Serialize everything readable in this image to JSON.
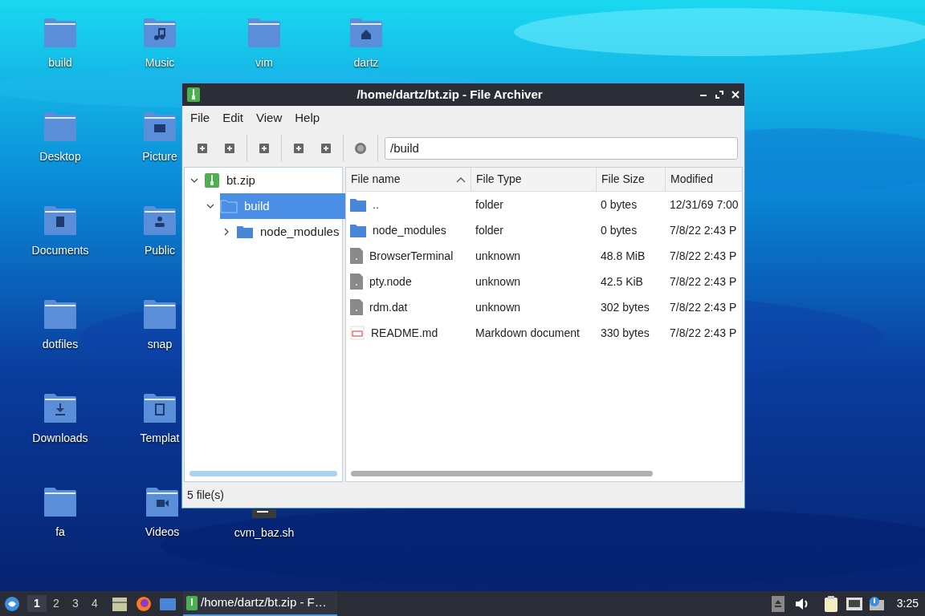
{
  "desktop": {
    "icons": [
      {
        "label": "build",
        "kind": "folder"
      },
      {
        "label": "Desktop",
        "kind": "folder"
      },
      {
        "label": "Documents",
        "kind": "documents"
      },
      {
        "label": "dotfiles",
        "kind": "folder"
      },
      {
        "label": "Downloads",
        "kind": "downloads"
      },
      {
        "label": "fa",
        "kind": "folder"
      },
      {
        "label": "Music",
        "kind": "music"
      },
      {
        "label": "Picture",
        "kind": "pictures"
      },
      {
        "label": "Public",
        "kind": "public"
      },
      {
        "label": "snap",
        "kind": "folder"
      },
      {
        "label": "Templat",
        "kind": "templates"
      },
      {
        "label": "Videos",
        "kind": "videos"
      },
      {
        "label": "vim",
        "kind": "folder"
      },
      {
        "label": "cvm_baz.sh",
        "kind": "script"
      },
      {
        "label": "dartz",
        "kind": "home"
      }
    ]
  },
  "window": {
    "title": "/home/dartz/bt.zip - File Archiver",
    "menu": [
      "File",
      "Edit",
      "View",
      "Help"
    ],
    "location": "/build",
    "tree": [
      {
        "label": "bt.zip",
        "kind": "archive",
        "expanded": true,
        "selected": false,
        "children": [
          {
            "label": "build",
            "kind": "folder",
            "expanded": true,
            "selected": true,
            "children": [
              {
                "label": "node_modules",
                "kind": "folder",
                "expanded": false,
                "selected": false
              }
            ]
          }
        ]
      }
    ],
    "table": {
      "columns": [
        {
          "label": "File name",
          "sorted": true
        },
        {
          "label": "File Type",
          "sorted": false
        },
        {
          "label": "File Size",
          "sorted": false
        },
        {
          "label": "Modified",
          "sorted": false
        }
      ],
      "rows": [
        {
          "kind": "folder",
          "name": "..",
          "type": "folder",
          "size": "0 bytes",
          "modified": "12/31/69 7:00"
        },
        {
          "kind": "folder",
          "name": "node_modules",
          "type": "folder",
          "size": "0 bytes",
          "modified": "7/8/22 2:43 P"
        },
        {
          "kind": "unknown",
          "name": "BrowserTerminal",
          "type": "unknown",
          "size": "48.8 MiB",
          "modified": "7/8/22 2:43 P"
        },
        {
          "kind": "unknown",
          "name": "pty.node",
          "type": "unknown",
          "size": "42.5 KiB",
          "modified": "7/8/22 2:43 P"
        },
        {
          "kind": "unknown",
          "name": "rdm.dat",
          "type": "unknown",
          "size": "302 bytes",
          "modified": "7/8/22 2:43 P"
        },
        {
          "kind": "markdown",
          "name": "README.md",
          "type": "Markdown document",
          "size": "330 bytes",
          "modified": "7/8/22 2:43 P"
        }
      ]
    },
    "status_bar": "5 file(s)"
  },
  "taskbar": {
    "workspaces": [
      {
        "label": "1",
        "selected": true
      },
      {
        "label": "2",
        "selected": false
      },
      {
        "label": "3",
        "selected": false
      },
      {
        "label": "4",
        "selected": false
      }
    ],
    "task": {
      "label": "/home/dartz/bt.zip - F…",
      "selected": true
    },
    "clock": "3:25"
  }
}
